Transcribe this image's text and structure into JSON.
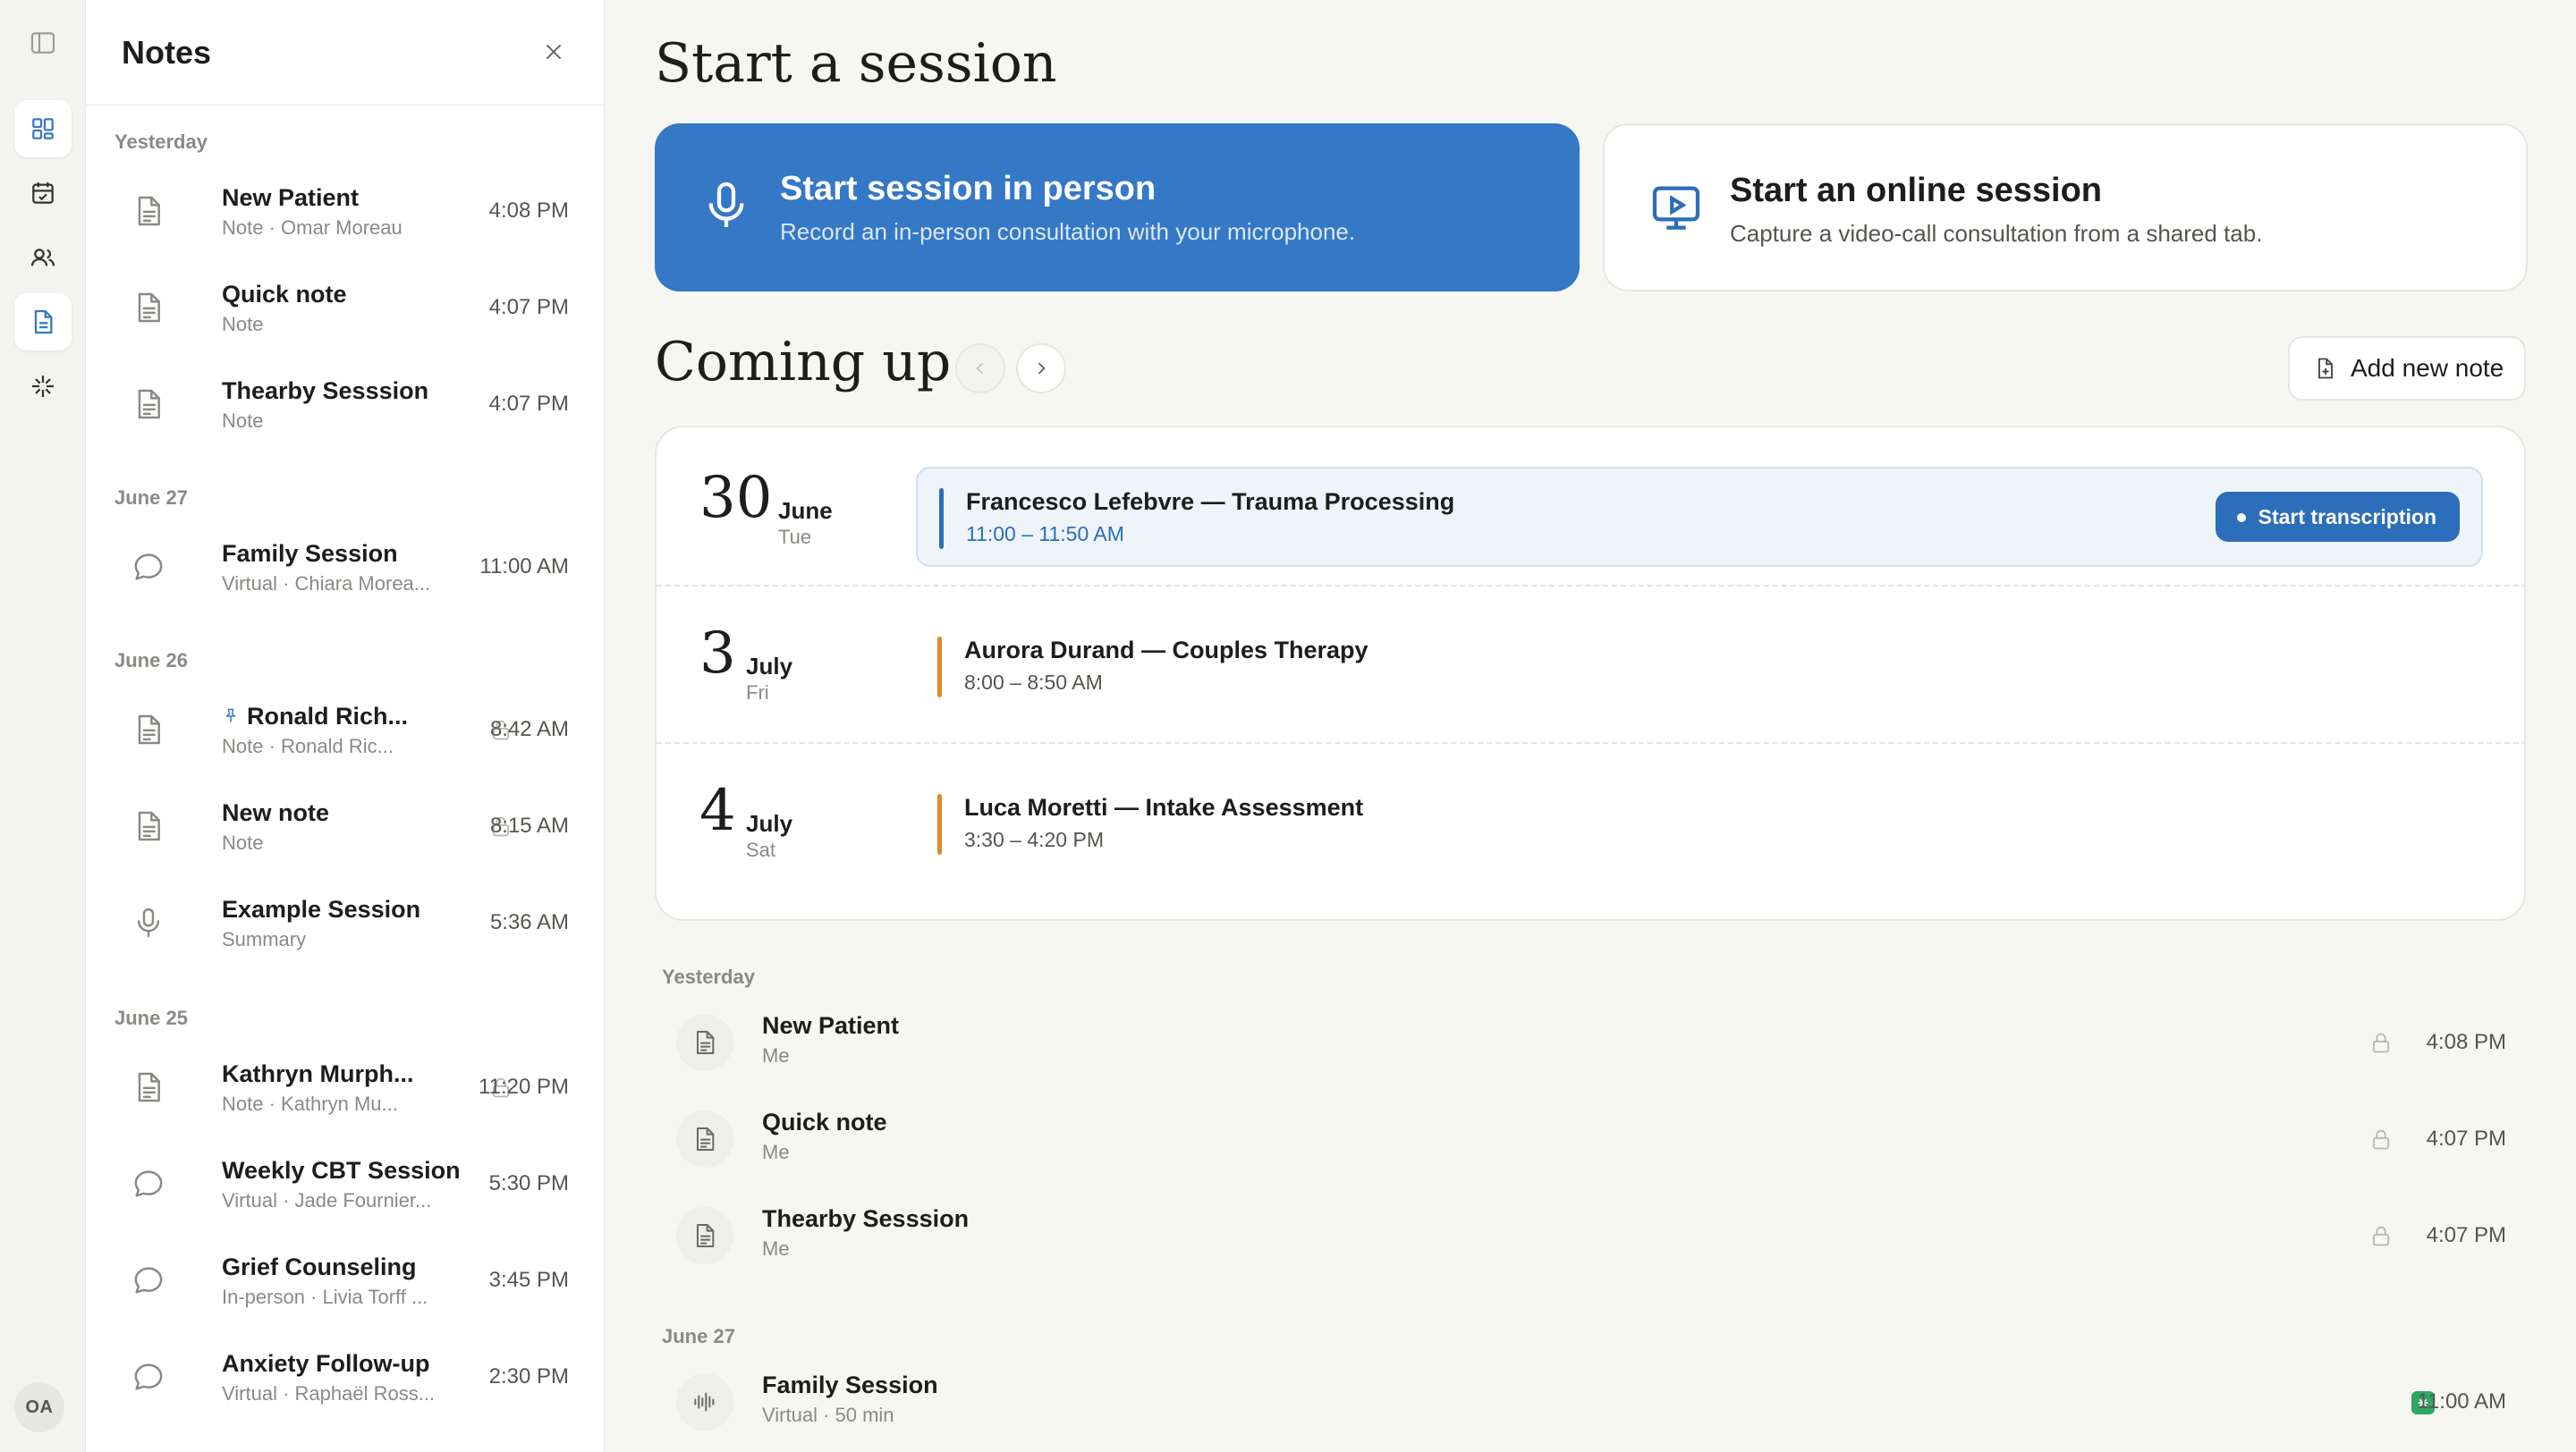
{
  "rail": {
    "avatar_initials": "OA",
    "items": [
      "sidebar-toggle-icon",
      "dashboard-icon",
      "calendar-icon",
      "users-icon",
      "notes-icon",
      "sparkle-icon"
    ],
    "accent": "#3478c6"
  },
  "notes_panel": {
    "title": "Notes",
    "groups": [
      {
        "label": "Yesterday",
        "items": [
          {
            "name": "New Patient",
            "sub": "Note · Omar Moreau",
            "time": "4:08 PM",
            "icon": "document-icon"
          },
          {
            "name": "Quick note",
            "sub": "Note",
            "time": "4:07 PM",
            "icon": "document-icon"
          },
          {
            "name": "Thearby Sesssion",
            "sub": "Note",
            "time": "4:07 PM",
            "icon": "document-icon"
          }
        ]
      },
      {
        "label": "June 27",
        "items": [
          {
            "name": "Family Session",
            "sub": "Virtual · Chiara Morea...",
            "time": "11:00 AM",
            "icon": "chat-bubble-icon"
          }
        ]
      },
      {
        "label": "June 26",
        "items": [
          {
            "name": "Ronald Rich...",
            "sub": "Note · Ronald Ric...",
            "time": "8:42 AM",
            "icon": "document-icon",
            "pinned": true,
            "locked": true
          },
          {
            "name": "New note",
            "sub": "Note",
            "time": "8:15 AM",
            "icon": "document-icon",
            "locked": true
          },
          {
            "name": "Example Session",
            "sub": "Summary",
            "time": "5:36 AM",
            "icon": "microphone-icon"
          }
        ]
      },
      {
        "label": "June 25",
        "items": [
          {
            "name": "Kathryn Murph...",
            "sub": "Note · Kathryn Mu...",
            "time": "11:20 PM",
            "icon": "document-icon",
            "locked": true
          },
          {
            "name": "Weekly CBT Session",
            "sub": "Virtual · Jade Fournier...",
            "time": "5:30 PM",
            "icon": "chat-bubble-icon"
          },
          {
            "name": "Grief Counseling",
            "sub": "In-person · Livia Torff ...",
            "time": "3:45 PM",
            "icon": "chat-bubble-icon"
          },
          {
            "name": "Anxiety Follow-up",
            "sub": "Virtual · Raphaël Ross...",
            "time": "2:30 PM",
            "icon": "chat-bubble-icon"
          }
        ]
      }
    ]
  },
  "main": {
    "title": "Start a session",
    "cards": {
      "in_person": {
        "title": "Start session in person",
        "subtitle": "Record an in-person consultation with your microphone."
      },
      "online": {
        "title": "Start an online session",
        "subtitle": "Capture a video-call consultation from a shared tab."
      }
    },
    "coming_up": {
      "title": "Coming up",
      "add_note_label": "Add new note",
      "appointments": [
        {
          "day": "30",
          "month": "June",
          "weekday": "Tue",
          "title": "Francesco Lefebvre — Trauma Processing",
          "hours": "11:00 – 11:50 AM",
          "bar_color": "#2c6eb9",
          "action": "Start transcription"
        },
        {
          "day": "3",
          "month": "July",
          "weekday": "Fri",
          "title": "Aurora Durand — Couples Therapy",
          "hours": "8:00 – 8:50 AM",
          "bar_color": "#e08a2c"
        },
        {
          "day": "4",
          "month": "July",
          "weekday": "Sat",
          "title": "Luca Moretti — Intake Assessment",
          "hours": "3:30 – 4:20 PM",
          "bar_color": "#e08a2c"
        }
      ]
    },
    "recent": {
      "groups": [
        {
          "label": "Yesterday",
          "items": [
            {
              "name": "New Patient",
              "sub": "Me",
              "time": "4:08 PM",
              "icon": "document-icon",
              "locked": true
            },
            {
              "name": "Quick note",
              "sub": "Me",
              "time": "4:07 PM",
              "icon": "document-icon",
              "locked": true
            },
            {
              "name": "Thearby Sesssion",
              "sub": "Me",
              "time": "4:07 PM",
              "icon": "document-icon",
              "locked": true
            }
          ]
        },
        {
          "label": "June 27",
          "items": [
            {
              "name": "Family Session",
              "sub": "Virtual · 50 min",
              "time": "11:00 AM",
              "icon": "waveform-icon",
              "badge": "green"
            }
          ]
        }
      ]
    }
  }
}
